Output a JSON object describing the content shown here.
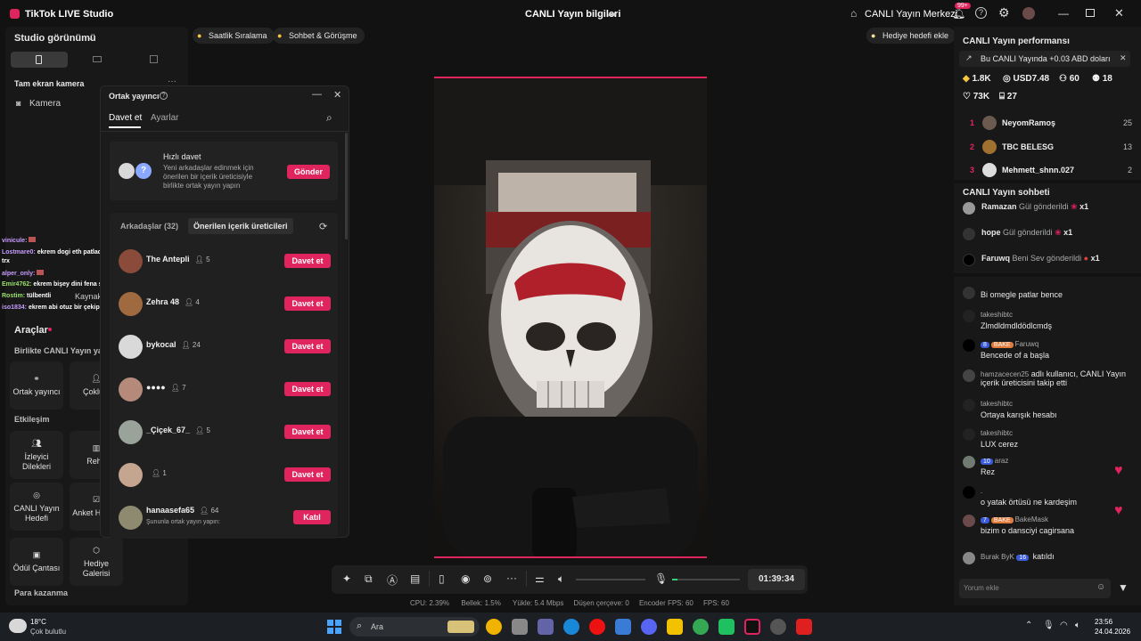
{
  "titlebar": {
    "app": "TikTok LIVE Studio",
    "center": "CANLI Yayın bilgileri",
    "live_center": "CANLI Yayın Merkezi",
    "notif": "99+"
  },
  "left": {
    "studio": "Studio görünümü",
    "camera_group": "Tam ekran kamera",
    "camera": "Kamera",
    "source": "Kaynak",
    "tools": "Araçlar",
    "birlikte": "Birlikte CANLI Yayın yapın",
    "interaction": "Etkileşim",
    "money": "Para kazanma",
    "tools_list": {
      "cohost": "Ortak yayıncı",
      "multi": "Çoklu k",
      "viewer": "İzleyici Dilekleri",
      "guide": "Rehb",
      "goal": "CANLI Yayın Hedefi",
      "poll": "Anket Hediye",
      "reward": "Ödül Çantası",
      "gallery": "Hediye Galerisi"
    }
  },
  "pills": {
    "hourly": "Saatlik Sıralama",
    "chat": "Sohbet & Görüşme",
    "gift_goal": "Hediyе hedefi ekle"
  },
  "dialog": {
    "title": "Ortak yayıncı",
    "tab_invite": "Davet et",
    "tab_settings": "Ayarlar",
    "quick_title": "Hızlı davet",
    "quick_desc": "Yeni arkadaşlar edinmek için önerilen bir içerik üreticisiyle birlikte ortak yayın yapın",
    "send": "Gönder",
    "friends": "Arkadaşlar (32)",
    "recommended": "Önerilen içerik üreticileri",
    "rows": [
      {
        "name": "The Antepli",
        "count": "5",
        "btn": "Davet et"
      },
      {
        "name": "Zehra 48",
        "count": "4",
        "btn": "Davet et"
      },
      {
        "name": "bykocal",
        "count": "24",
        "btn": "Davet et"
      },
      {
        "name": "●●●●",
        "count": "7",
        "btn": "Davet et"
      },
      {
        "name": "_Çiçek_67_",
        "count": "5",
        "btn": "Davet et"
      },
      {
        "name": "",
        "count": "1",
        "btn": "Davet et"
      },
      {
        "name": "hanaasefa65",
        "count": "64",
        "btn": "Katıl",
        "sub": "Şununla ortak yayın yapın:"
      }
    ]
  },
  "overlay": [
    {
      "u": "vinicule:",
      "m": ""
    },
    {
      "u": "Lostmare0:",
      "m": "ekrem dogi eth patladı kralım en mantıklısı btc"
    },
    {
      "u": "",
      "m": "trx"
    },
    {
      "u": "alper_only:",
      "m": ""
    },
    {
      "u": "Emir4762:",
      "m": "ekrem bişey dini fena sarar o"
    },
    {
      "u": "Rostim:",
      "m": "tülbentli"
    },
    {
      "u": "iso1834:",
      "m": "ekrem abi otuz bir çekip yine yayın açıcan mk"
    }
  ],
  "right": {
    "perf": "CANLI Yayın performansı",
    "banner": "Bu CANLI Yayında +0.03 ABD doları",
    "stats": {
      "diamonds": "1.8K",
      "usd": "USD7.48",
      "viewers": "60",
      "users": "18",
      "likes": "73K",
      "gifts": "27"
    },
    "ranking": [
      {
        "n": "1",
        "name": "NeyomRamoş",
        "v": "25"
      },
      {
        "n": "2",
        "name": "TBC BELESG",
        "v": "13"
      },
      {
        "n": "3",
        "name": "Mehmett_shnn.027",
        "v": "2"
      }
    ],
    "chat_title": "CANLI Yayın sohbeti",
    "gifts": [
      {
        "u": "Ramazan",
        "a": "Gül gönderildi",
        "x": "x1"
      },
      {
        "u": "hope",
        "a": "Gül gönderildi",
        "x": "x1"
      },
      {
        "u": "Faruwq",
        "a": "Beni Sev gönderildi",
        "x": "x1"
      }
    ],
    "comments": [
      {
        "u": "",
        "m": "Bi omegle patlar bence"
      },
      {
        "u": "takeshibtc",
        "m": "Zlmdldmdldödlcmdş"
      },
      {
        "u": "Faruwq",
        "b1": "8",
        "b2": "BAKE",
        "m": "Bencede of a başla"
      },
      {
        "u": "hamzacecen25",
        "m": "adlı kullanıcı, CANLI Yayın içerik üreticisini takip etti"
      },
      {
        "u": "takeshibtc",
        "m": "Ortaya karışık hesabı"
      },
      {
        "u": "takeshibtc",
        "m": "LUX cerez"
      },
      {
        "u": "araz",
        "b1": "10",
        "m": "Rez"
      },
      {
        "u": ".",
        "m": "o yatak örtüsü ne kardeşim"
      },
      {
        "u": "BakeMask",
        "b1": "7",
        "b2": "BAKE",
        "m": "bizim o dansciyi cagirsana"
      },
      {
        "u": "Burak ByK",
        "b1": "16",
        "m": "katıldı"
      }
    ],
    "comment_placeholder": "Yorum ekle"
  },
  "controls": {
    "timer": "01:39:34"
  },
  "stats": {
    "cpu": "CPU: 2.39%",
    "mem": "Bellek: 1.5%",
    "upload": "Yükle: 5.4 Mbps",
    "drop": "Düşen çerçeve: 0",
    "enc": "Encoder FPS: 60",
    "fps": "FPS: 60"
  },
  "taskbar": {
    "temp": "18°C",
    "weather": "Çok bulutlu",
    "search": "Ara",
    "time": "23:56",
    "date": "24.04.2026"
  }
}
